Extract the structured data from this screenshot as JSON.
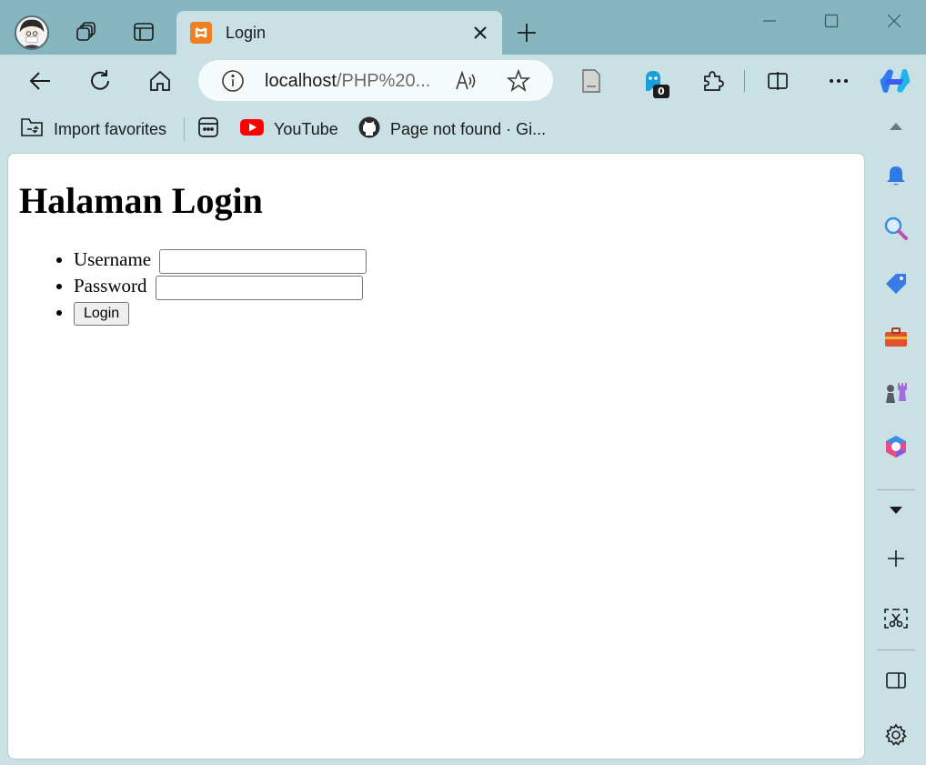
{
  "window": {
    "tab": {
      "title": "Login"
    }
  },
  "toolbar": {
    "url_host": "localhost",
    "url_path": "/PHP%20...",
    "extension_badge": "0"
  },
  "favorites": [
    {
      "label": "Import favorites",
      "icon": "import-favorites-icon"
    },
    {
      "label": "",
      "icon": "apps-icon"
    },
    {
      "label": "YouTube",
      "icon": "youtube-icon"
    },
    {
      "label": "Page not found · Gi...",
      "icon": "github-icon"
    }
  ],
  "page": {
    "heading": "Halaman Login",
    "username_label": "Username",
    "username_value": "",
    "password_label": "Password",
    "password_value": "",
    "login_button": "Login"
  },
  "colors": {
    "tab_strip": "#86b6bf",
    "chrome": "#c9e0e4",
    "page_bg": "#ffffff"
  }
}
